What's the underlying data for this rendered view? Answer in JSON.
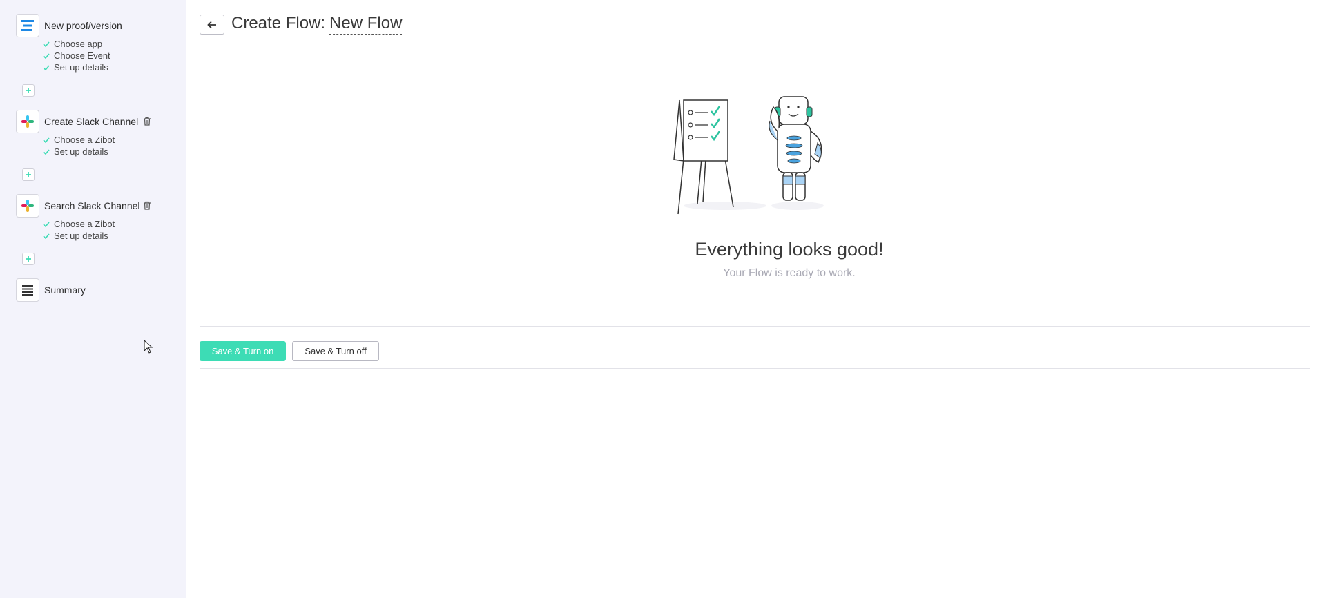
{
  "sidebar": {
    "steps": [
      {
        "title": "New proof/version",
        "icon": "app-lines-icon",
        "substeps": [
          "Choose app",
          "Choose Event",
          "Set up details"
        ]
      },
      {
        "title": "Create Slack Channel",
        "icon": "slack-icon",
        "substeps": [
          "Choose a Zibot",
          "Set up details"
        ]
      },
      {
        "title": "Search Slack Channel",
        "icon": "slack-icon",
        "substeps": [
          "Choose a Zibot",
          "Set up details"
        ]
      },
      {
        "title": "Summary",
        "icon": "summary-lines-icon",
        "substeps": []
      }
    ]
  },
  "header": {
    "title_prefix": "Create Flow:",
    "flow_name": "New Flow"
  },
  "status": {
    "title": "Everything looks good!",
    "subtitle": "Your Flow is ready to work."
  },
  "actions": {
    "save_on": "Save & Turn on",
    "save_off": "Save & Turn off"
  },
  "colors": {
    "accent": "#3ddcb5",
    "sidebar_bg": "#f3f3fb",
    "check": "#3ddcb5"
  }
}
